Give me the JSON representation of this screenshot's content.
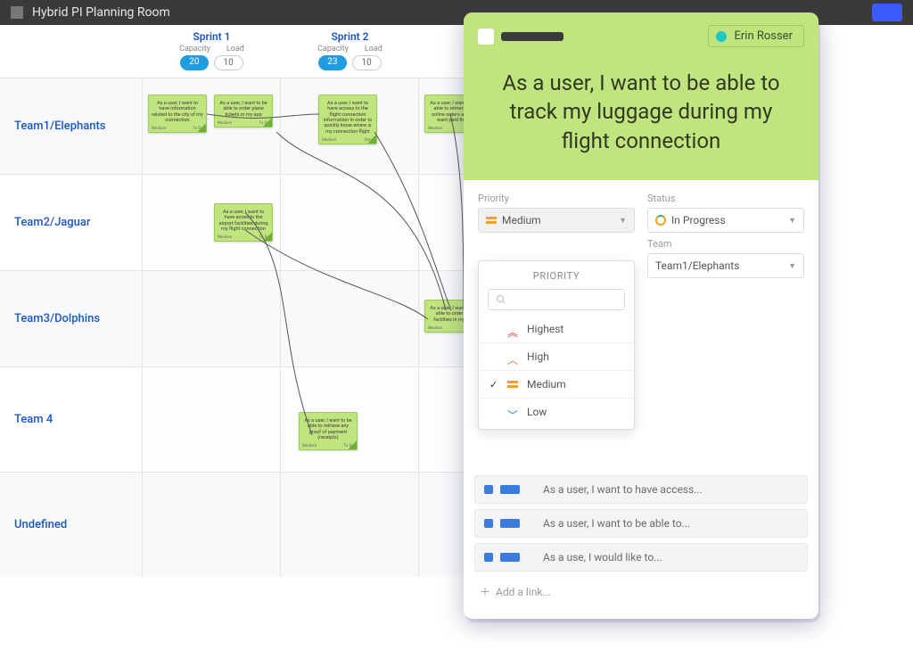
{
  "topbar": {
    "title": "Hybrid PI Planning Room"
  },
  "sprints": [
    {
      "title": "Sprint 1",
      "cap_label": "Capacity",
      "load_label": "Load",
      "capacity": "20",
      "load": "10"
    },
    {
      "title": "Sprint 2",
      "cap_label": "Capacity",
      "load_label": "Load",
      "capacity": "23",
      "load": "10"
    }
  ],
  "teams": [
    "Team1/Elephants",
    "Team2/Jaguar",
    "Team3/Dolphins",
    "Team 4",
    "Undefined"
  ],
  "cards": {
    "c1": "As a user, I want to have information related to the city of my connection",
    "c2": "As a user, I want to be able to order plane tickets in my app",
    "c3": "As a user, I want to have access to the flight connection information in order to quickly know where is my connection flight",
    "c4": "As a user, I want to be able to retrieve my online orders and if I want paid them",
    "c5": "As a user, I want to have acces to the airport facilities during my flight connection",
    "c6": "As a user, I want to be able to order any facilities in my app",
    "c7": "As a user, I want to be able to retrieve any proof of payment (receipts)"
  },
  "panel": {
    "user": "Erin Rosser",
    "title": "As a user, I want to be able to track my luggage during my flight connection",
    "labels": {
      "priority": "Priority",
      "status": "Status",
      "team": "Team"
    },
    "priority_value": "Medium",
    "status_value": "In Progress",
    "team_value": "Team1/Elephants",
    "dropdown_title": "PRIORITY",
    "options": {
      "highest": "Highest",
      "high": "High",
      "medium": "Medium",
      "low": "Low"
    },
    "links": [
      "As a user, I want to have access...",
      "As a user, I want to be able to...",
      "As a use, I would like to..."
    ],
    "add_link": "Add a link..."
  }
}
